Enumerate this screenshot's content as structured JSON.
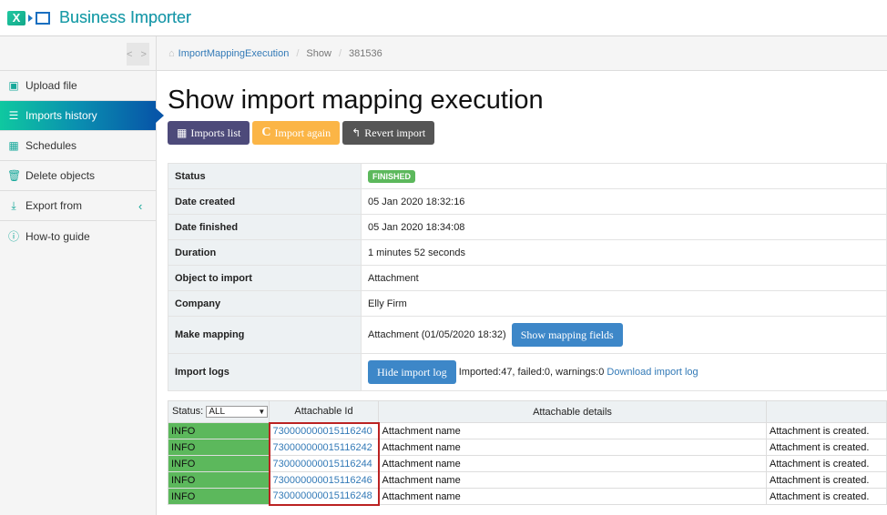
{
  "app": {
    "title": "Business Importer",
    "logo_icon": "x-arrow-box-icon"
  },
  "sidebar": {
    "toggle_label": "< >",
    "items": [
      {
        "label": "Upload file",
        "icon": "excel-file-icon",
        "glyph": "▣",
        "active": false
      },
      {
        "label": "Imports history",
        "icon": "list-icon",
        "glyph": "☰",
        "active": true
      },
      {
        "label": "Schedules",
        "icon": "calendar-icon",
        "glyph": "▦",
        "active": false
      },
      {
        "label": "Delete objects",
        "icon": "trash-icon",
        "glyph": "🗑",
        "active": false
      },
      {
        "label": "Export from",
        "icon": "download-icon",
        "glyph": "⤓",
        "active": false,
        "chevron": "‹"
      },
      {
        "label": "How-to guide",
        "icon": "info-circle-icon",
        "glyph": "ⓘ",
        "active": false
      }
    ]
  },
  "breadcrumb": {
    "home_glyph": "⌂",
    "link": "ImportMappingExecution",
    "items": [
      "Show",
      "381536"
    ]
  },
  "page": {
    "title": "Show import mapping execution"
  },
  "actions": {
    "imports_list": "Imports list",
    "import_again": "Import again",
    "revert_import": "Revert import"
  },
  "details": {
    "status_label": "Status",
    "status_value": "FINISHED",
    "date_created_label": "Date created",
    "date_created_value": "05 Jan 2020 18:32:16",
    "date_finished_label": "Date finished",
    "date_finished_value": "05 Jan 2020 18:34:08",
    "duration_label": "Duration",
    "duration_value": "1 minutes 52 seconds",
    "object_label": "Object to import",
    "object_value": "Attachment",
    "company_label": "Company",
    "company_value": "Elly Firm",
    "mapping_label": "Make mapping",
    "mapping_value": "Attachment (01/05/2020 18:32)",
    "mapping_button": "Show mapping fields",
    "logs_label": "Import logs",
    "logs_button": "Hide import log",
    "logs_summary": "Imported:47, failed:0, warnings:0",
    "logs_download": "Download import log"
  },
  "log_table": {
    "status_filter_label": "Status:",
    "status_filter_value": "ALL",
    "columns": [
      "Attachable Id",
      "Attachable details",
      ""
    ],
    "rows": [
      {
        "status": "INFO",
        "id": "730000000015116240",
        "details": "Attachment name",
        "message": "Attachment is created."
      },
      {
        "status": "INFO",
        "id": "730000000015116242",
        "details": "Attachment name",
        "message": "Attachment is created."
      },
      {
        "status": "INFO",
        "id": "730000000015116244",
        "details": "Attachment name",
        "message": "Attachment is created."
      },
      {
        "status": "INFO",
        "id": "730000000015116246",
        "details": "Attachment name",
        "message": "Attachment is created."
      },
      {
        "status": "INFO",
        "id": "730000000015116248",
        "details": "Attachment name",
        "message": "Attachment is created."
      }
    ]
  }
}
